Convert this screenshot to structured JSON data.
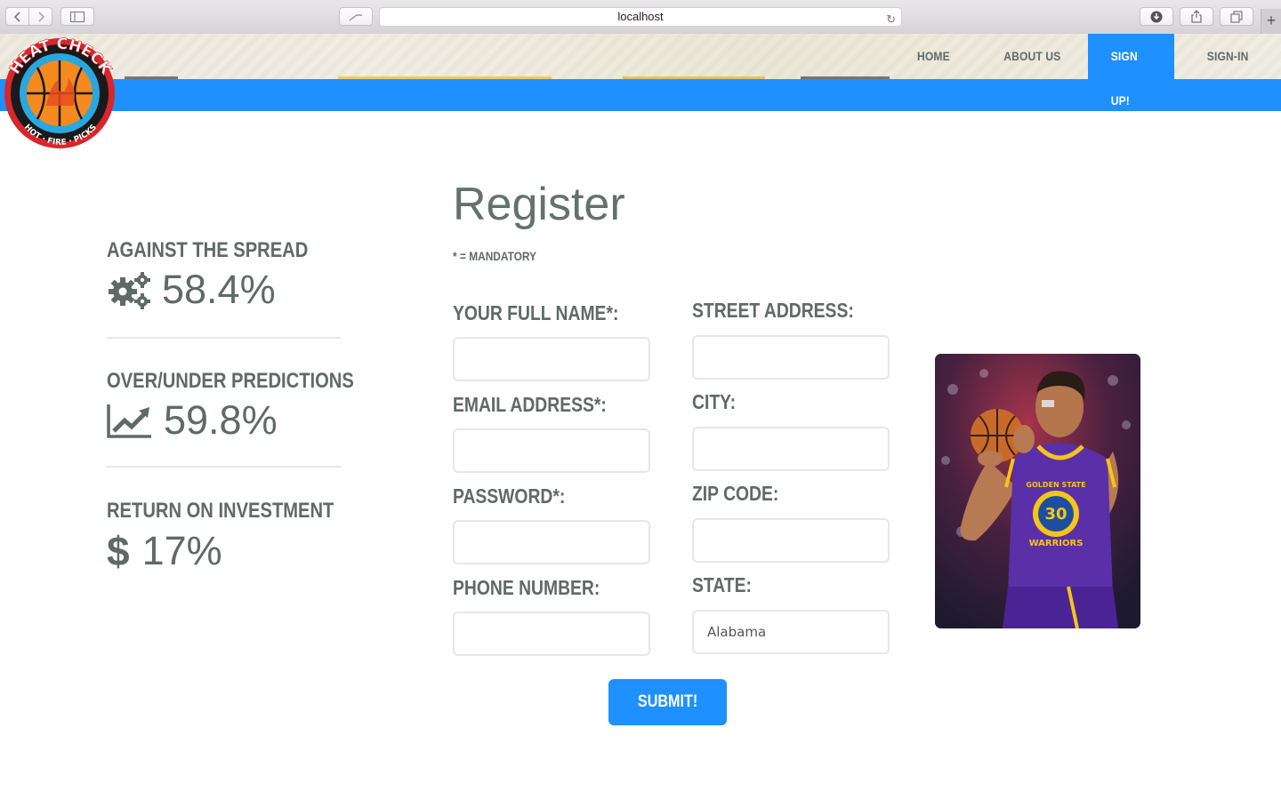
{
  "browser": {
    "url": "localhost"
  },
  "site": {
    "logo": {
      "top_text": "HEAT CHECK",
      "bottom_text": "HOT · FIRE · PICKS"
    },
    "nav": [
      {
        "label": "HOME",
        "active": false
      },
      {
        "label": "ABOUT US",
        "active": false
      },
      {
        "label": "SIGN UP!",
        "active": true
      },
      {
        "label": "SIGN-IN",
        "active": false
      }
    ],
    "accent_color": "#1e90ff"
  },
  "stats": [
    {
      "label": "AGAINST THE SPREAD",
      "value": "58.4%",
      "icon": "gears-icon"
    },
    {
      "label": "OVER/UNDER PREDICTIONS",
      "value": "59.8%",
      "icon": "line-chart-icon"
    },
    {
      "label": "RETURN ON INVESTMENT",
      "value": "17%",
      "icon": "dollar-icon"
    }
  ],
  "form": {
    "title": "Register",
    "mandatory_note": "* = MANDATORY",
    "left_fields": [
      {
        "label": "YOUR FULL NAME*:",
        "value": ""
      },
      {
        "label": "EMAIL ADDRESS*:",
        "value": ""
      },
      {
        "label": "PASSWORD*:",
        "value": ""
      },
      {
        "label": "PHONE NUMBER:",
        "value": ""
      }
    ],
    "right_fields": [
      {
        "label": "STREET ADDRESS:",
        "value": ""
      },
      {
        "label": "CITY:",
        "value": ""
      },
      {
        "label": "ZIP CODE:",
        "value": ""
      },
      {
        "label": "STATE:",
        "value": "Alabama"
      }
    ],
    "submit_label": "SUBMIT!"
  },
  "photo": {
    "jersey_text": "GOLDEN STATE",
    "jersey_number": "30",
    "jersey_team": "WARRIORS"
  }
}
